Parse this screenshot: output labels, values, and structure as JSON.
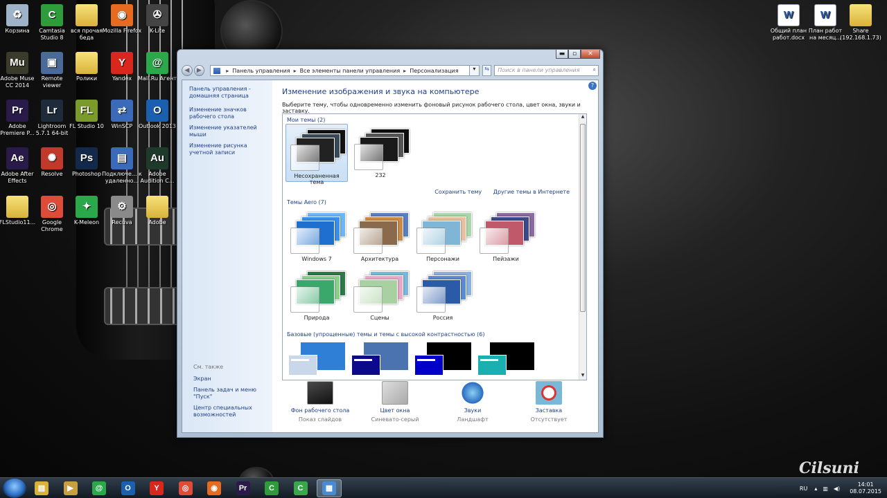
{
  "desktop": {
    "icons_left": [
      {
        "label": "Корзина",
        "icon": "recycle-bin-icon",
        "color": "#9fb3c8",
        "glyph": "♻"
      },
      {
        "label": "Camtasia Studio 8",
        "icon": "camtasia-icon",
        "color": "#2e9c3b",
        "glyph": "C"
      },
      {
        "label": "вся прочая беда",
        "icon": "folder-icon",
        "color": "#d9b23a",
        "glyph": ""
      },
      {
        "label": "Mozilla Firefox",
        "icon": "firefox-icon",
        "color": "#e66a1f",
        "glyph": "◉"
      },
      {
        "label": "K-Lite",
        "icon": "klite-icon",
        "color": "#444444",
        "glyph": "✇"
      },
      {
        "label": "Adobe Muse CC 2014",
        "icon": "adobe-muse-icon",
        "color": "#3b3b2b",
        "glyph": "Mu"
      },
      {
        "label": "Remote viewer",
        "icon": "remote-viewer-icon",
        "color": "#4a6b9a",
        "glyph": "▣"
      },
      {
        "label": "Ролики",
        "icon": "folder-icon",
        "color": "#d9b23a",
        "glyph": ""
      },
      {
        "label": "Yandex",
        "icon": "yandex-icon",
        "color": "#d8281e",
        "glyph": "Y"
      },
      {
        "label": "Mail.Ru Агент",
        "icon": "mailru-agent-icon",
        "color": "#2aa84a",
        "glyph": "@"
      },
      {
        "label": "Adobe Premiere P...",
        "icon": "premiere-icon",
        "color": "#2a1a4a",
        "glyph": "Pr"
      },
      {
        "label": "Lightroom 5.7.1 64-bit",
        "icon": "lightroom-icon",
        "color": "#1e2b3a",
        "glyph": "Lr"
      },
      {
        "label": "FL Studio 10",
        "icon": "fl-studio-icon",
        "color": "#7a9a2a",
        "glyph": "FL"
      },
      {
        "label": "WinSCP",
        "icon": "winscp-icon",
        "color": "#3a6ab8",
        "glyph": "⇄"
      },
      {
        "label": "Outlook 2013",
        "icon": "outlook-icon",
        "color": "#1b5fb0",
        "glyph": "O"
      },
      {
        "label": "Adobe After Effects",
        "icon": "after-effects-icon",
        "color": "#2a1a4a",
        "glyph": "Ae"
      },
      {
        "label": "Resolve",
        "icon": "resolve-icon",
        "color": "#c0392b",
        "glyph": "✺"
      },
      {
        "label": "Photoshop",
        "icon": "photoshop-icon",
        "color": "#12294a",
        "glyph": "Ps"
      },
      {
        "label": "Подключе... к удаленно...",
        "icon": "remote-desktop-icon",
        "color": "#3a6ab8",
        "glyph": "▤"
      },
      {
        "label": "Adobe Audition C...",
        "icon": "audition-icon",
        "color": "#1e3a2a",
        "glyph": "Au"
      },
      {
        "label": "FLStudio11...",
        "icon": "folder-icon",
        "color": "#d9b23a",
        "glyph": ""
      },
      {
        "label": "Google Chrome",
        "icon": "chrome-icon",
        "color": "#dd4b39",
        "glyph": "◎"
      },
      {
        "label": "K-Meleon",
        "icon": "kmeleon-icon",
        "color": "#2aa84a",
        "glyph": "✦"
      },
      {
        "label": "Recuva",
        "icon": "recuva-icon",
        "color": "#8a8a8a",
        "glyph": "⚙"
      },
      {
        "label": "Adobe",
        "icon": "folder-icon",
        "color": "#d9b23a",
        "glyph": ""
      }
    ],
    "icons_right": [
      {
        "label": "Общий план работ.docx",
        "icon": "word-doc-icon"
      },
      {
        "label": "План работ на месяц...",
        "icon": "word-doc-icon"
      },
      {
        "label": "Share (192.168.1.73)",
        "icon": "share-folder-icon"
      }
    ]
  },
  "window": {
    "caption": {
      "min": "▬",
      "max": "▫",
      "close": "✕"
    },
    "breadcrumb": [
      "Панель управления",
      "Все элементы панели управления",
      "Персонализация"
    ],
    "refresh": "⇆",
    "search_placeholder": "Поиск в панели управления",
    "search_icon": "⌕",
    "help": "?",
    "left": {
      "links": [
        "Панель управления - домашняя страница",
        "Изменение значков рабочего стола",
        "Изменение указателей мыши",
        "Изменение рисунка учетной записи"
      ],
      "see_also": "См. также",
      "see_also_links": [
        "Экран",
        "Панель задач и меню \"Пуск\"",
        "Центр специальных возможностей"
      ]
    },
    "main": {
      "heading": "Изменение изображения и звука на компьютере",
      "description": "Выберите тему, чтобы одновременно изменить фоновый рисунок рабочего стола, цвет окна, звуки и заставку.",
      "my_themes_header": "Мои темы (2)",
      "my_themes": [
        {
          "label": "Несохраненная тема",
          "selected": true,
          "c1": "#222222",
          "c2": "#3a4a5a",
          "c3": "#111111"
        },
        {
          "label": "232",
          "selected": false,
          "c1": "#1a1a1a",
          "c2": "#555555",
          "c3": "#0e0e0e"
        }
      ],
      "save_theme_link": "Сохранить тему",
      "online_themes_link": "Другие темы в Интернете",
      "aero_header": "Темы Aero (7)",
      "aero_themes": [
        {
          "label": "Windows 7",
          "c1": "#1e6fd0",
          "c2": "#3c8ee8",
          "c3": "#6fb5f5"
        },
        {
          "label": "Архитектура",
          "c1": "#8a6a4a",
          "c2": "#c98a4a",
          "c3": "#5a7fbf"
        },
        {
          "label": "Персонажи",
          "c1": "#7fb5d5",
          "c2": "#e8c0a0",
          "c3": "#a8d8a8"
        },
        {
          "label": "Пейзажи",
          "c1": "#c05a6a",
          "c2": "#3a4a8a",
          "c3": "#8a6aa0"
        },
        {
          "label": "Природа",
          "c1": "#3aa86a",
          "c2": "#8ad08a",
          "c3": "#2a7a4a"
        },
        {
          "label": "Сцены",
          "c1": "#a8d0a0",
          "c2": "#e8a8c8",
          "c3": "#7ab8d8"
        },
        {
          "label": "Россия",
          "c1": "#2a5aa8",
          "c2": "#5a8ad0",
          "c3": "#8ab0e0"
        }
      ],
      "basic_header": "Базовые (упрощенные) темы и темы с высокой контрастностью (6)",
      "basic_themes": [
        {
          "bg": "#2f7fd6",
          "sw": "#c8d8ea"
        },
        {
          "bg": "#4a73b0",
          "sw": "#0a0a8a"
        },
        {
          "bg": "#000000",
          "sw": "#0000c8"
        },
        {
          "bg": "#000000",
          "sw": "#1ab0b0"
        }
      ],
      "bottom": [
        {
          "label": "Фон рабочего стола",
          "sub": "Показ слайдов",
          "icon": "desktop-background-icon"
        },
        {
          "label": "Цвет окна",
          "sub": "Синевато-серый",
          "icon": "window-color-icon"
        },
        {
          "label": "Звуки",
          "sub": "Ландшафт",
          "icon": "sounds-icon"
        },
        {
          "label": "Заставка",
          "sub": "Отсутствует",
          "icon": "screensaver-icon"
        }
      ]
    }
  },
  "taskbar": {
    "items": [
      {
        "name": "explorer-icon",
        "glyph": "▤",
        "color": "#d9b23a"
      },
      {
        "name": "media-player-icon",
        "glyph": "▶",
        "color": "#c8a040"
      },
      {
        "name": "mailru-agent-icon",
        "glyph": "@",
        "color": "#2aa84a"
      },
      {
        "name": "outlook-icon",
        "glyph": "O",
        "color": "#1b5fb0"
      },
      {
        "name": "yandex-icon",
        "glyph": "Y",
        "color": "#d8281e"
      },
      {
        "name": "chrome-icon",
        "glyph": "◎",
        "color": "#dd4b39"
      },
      {
        "name": "firefox-icon",
        "glyph": "◉",
        "color": "#e66a1f"
      },
      {
        "name": "premiere-icon",
        "glyph": "Pr",
        "color": "#2a1a4a"
      },
      {
        "name": "camtasia-recorder-icon",
        "glyph": "C",
        "color": "#2e9c3b"
      },
      {
        "name": "camtasia-studio-icon",
        "glyph": "C",
        "color": "#3aa84a"
      },
      {
        "name": "control-panel-icon",
        "glyph": "▦",
        "color": "#4a8ad0"
      }
    ],
    "lang": "RU",
    "time": "14:01",
    "date": "08.07.2015"
  },
  "watermark": "Cilsuni"
}
